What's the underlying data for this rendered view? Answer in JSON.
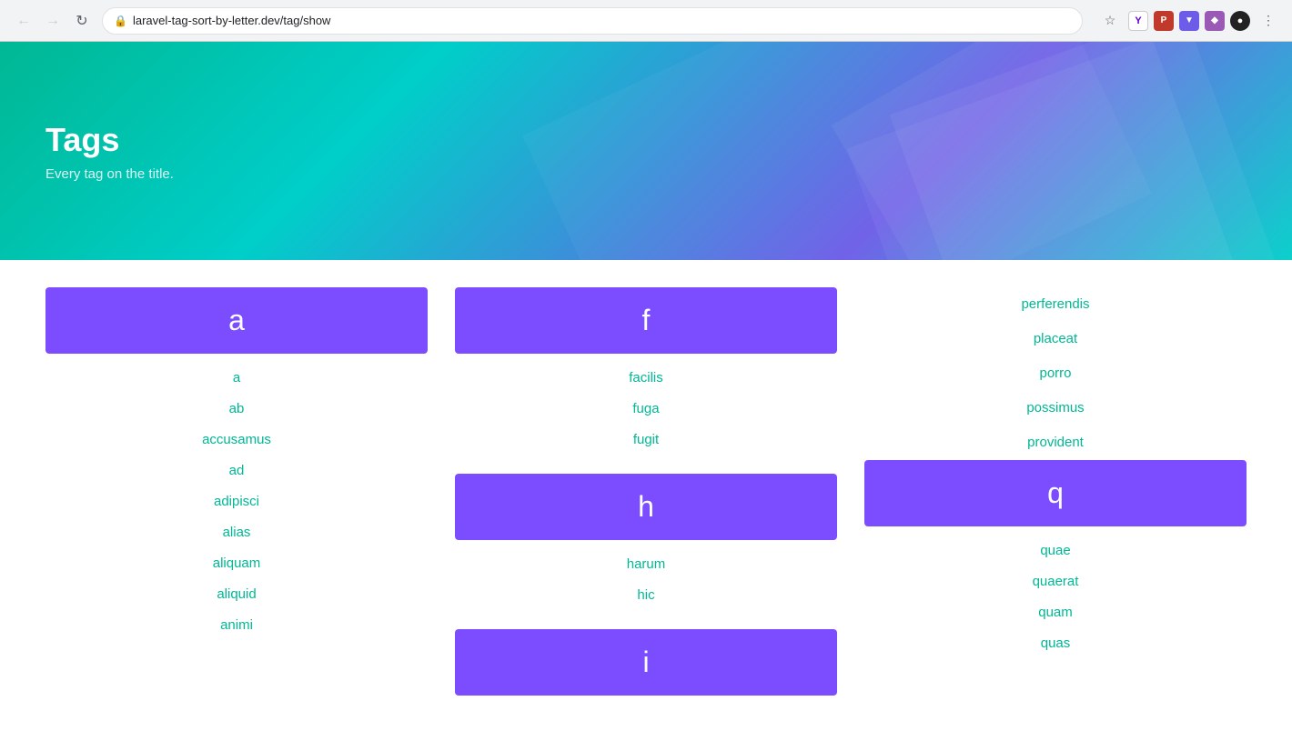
{
  "browser": {
    "url": "laravel-tag-sort-by-letter.dev/tag/show",
    "back_label": "←",
    "forward_label": "→",
    "reload_label": "↻"
  },
  "hero": {
    "title": "Tags",
    "subtitle": "Every tag on the title."
  },
  "columns": [
    {
      "id": "col-a",
      "sections": [
        {
          "letter": "a",
          "tags": [
            "a",
            "ab",
            "accusamus",
            "ad",
            "adipisci",
            "alias",
            "aliquam",
            "aliquid",
            "animi"
          ]
        }
      ]
    },
    {
      "id": "col-f",
      "sections": [
        {
          "letter": "f",
          "tags": [
            "facilis",
            "fuga",
            "fugit"
          ]
        },
        {
          "letter": "h",
          "tags": [
            "harum",
            "hic"
          ]
        },
        {
          "letter": "i",
          "tags": []
        }
      ]
    },
    {
      "id": "col-p",
      "sections": [
        {
          "letter": null,
          "tags": [
            "perferendis",
            "placeat",
            "porro",
            "possimus",
            "provident"
          ]
        },
        {
          "letter": "q",
          "tags": [
            "quae",
            "quaerat",
            "quam",
            "quas"
          ]
        }
      ]
    }
  ]
}
